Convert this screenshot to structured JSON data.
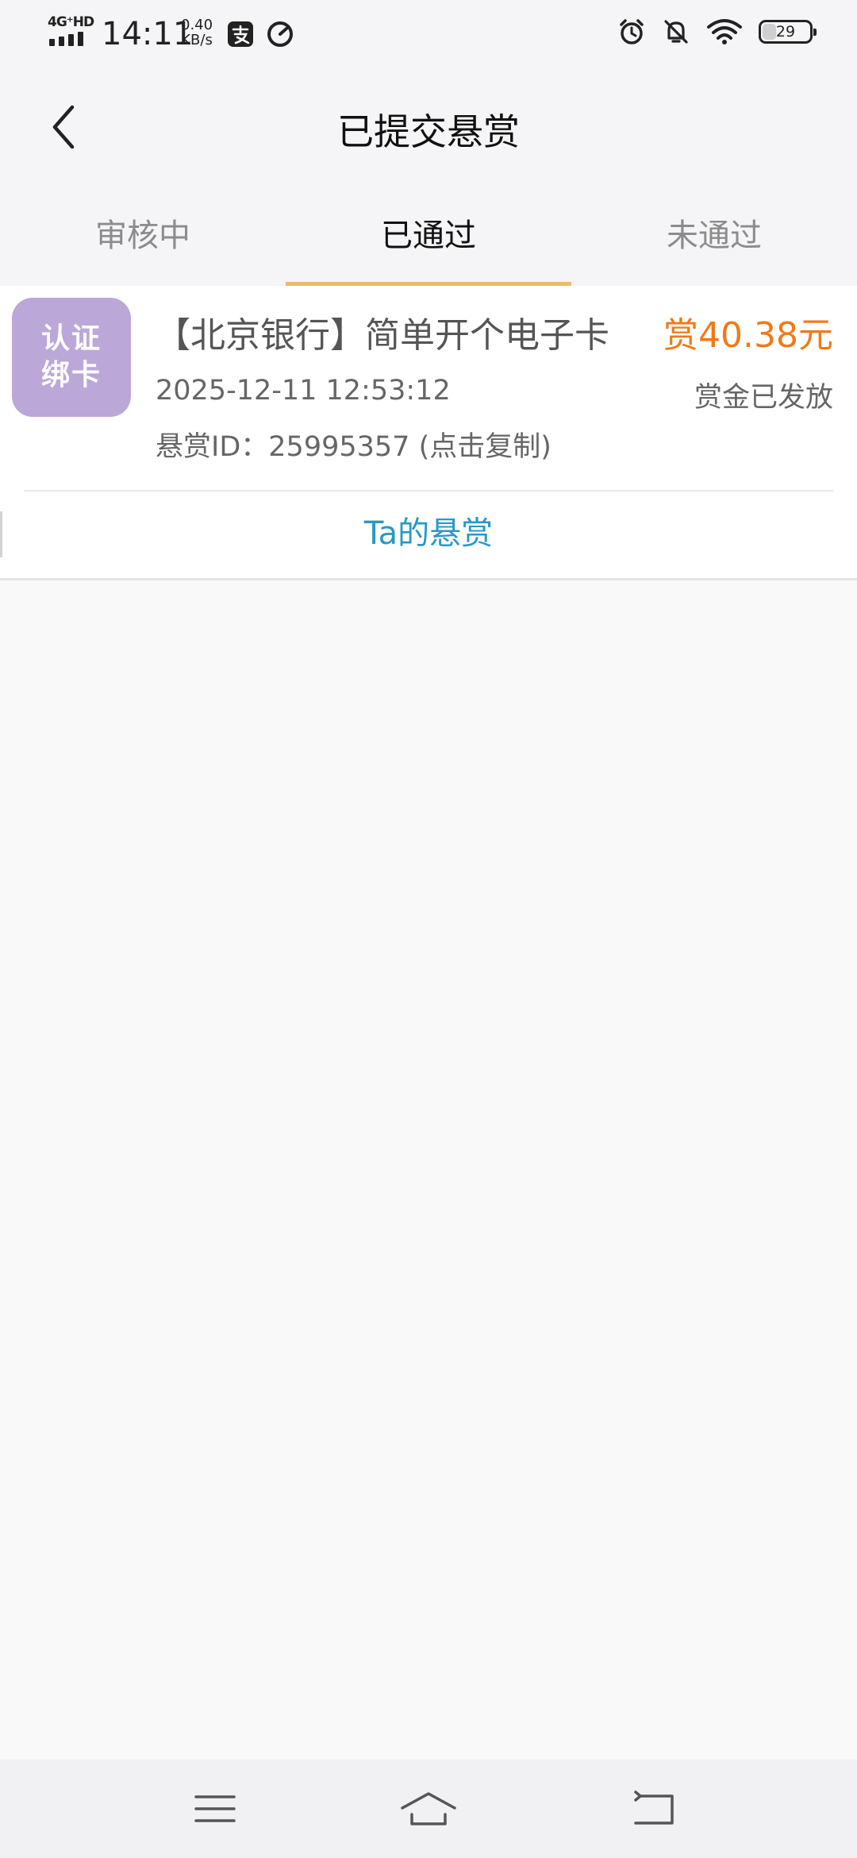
{
  "status_bar": {
    "network": "4G⁺HD",
    "time": "14:11",
    "speed_value": "0.40",
    "speed_unit": "KB/s",
    "battery": "29",
    "battery_level": 0.29
  },
  "header": {
    "title": "已提交悬赏",
    "back_icon": "chevron-left-icon"
  },
  "tabs": [
    {
      "label": "审核中",
      "active": false
    },
    {
      "label": "已通过",
      "active": true
    },
    {
      "label": "未通过",
      "active": false
    }
  ],
  "task": {
    "thumb_line1": "认证",
    "thumb_line2": "绑卡",
    "title": "【北京银行】简单开个电子卡",
    "reward": "赏40.38元",
    "submitted_at": "2025-12-11 12:53:12",
    "status": "赏金已发放",
    "id_label": "悬赏ID：",
    "id_value": "25995357",
    "copy_hint": " (点击复制)",
    "link": "Ta的悬赏"
  },
  "colors": {
    "accent": "#e8bc6a",
    "reward": "#ef7a17",
    "link": "#2a98c4",
    "thumb": "#bba7d8"
  },
  "nav": {
    "icons": [
      "menu-icon",
      "home-icon",
      "back-icon"
    ]
  }
}
